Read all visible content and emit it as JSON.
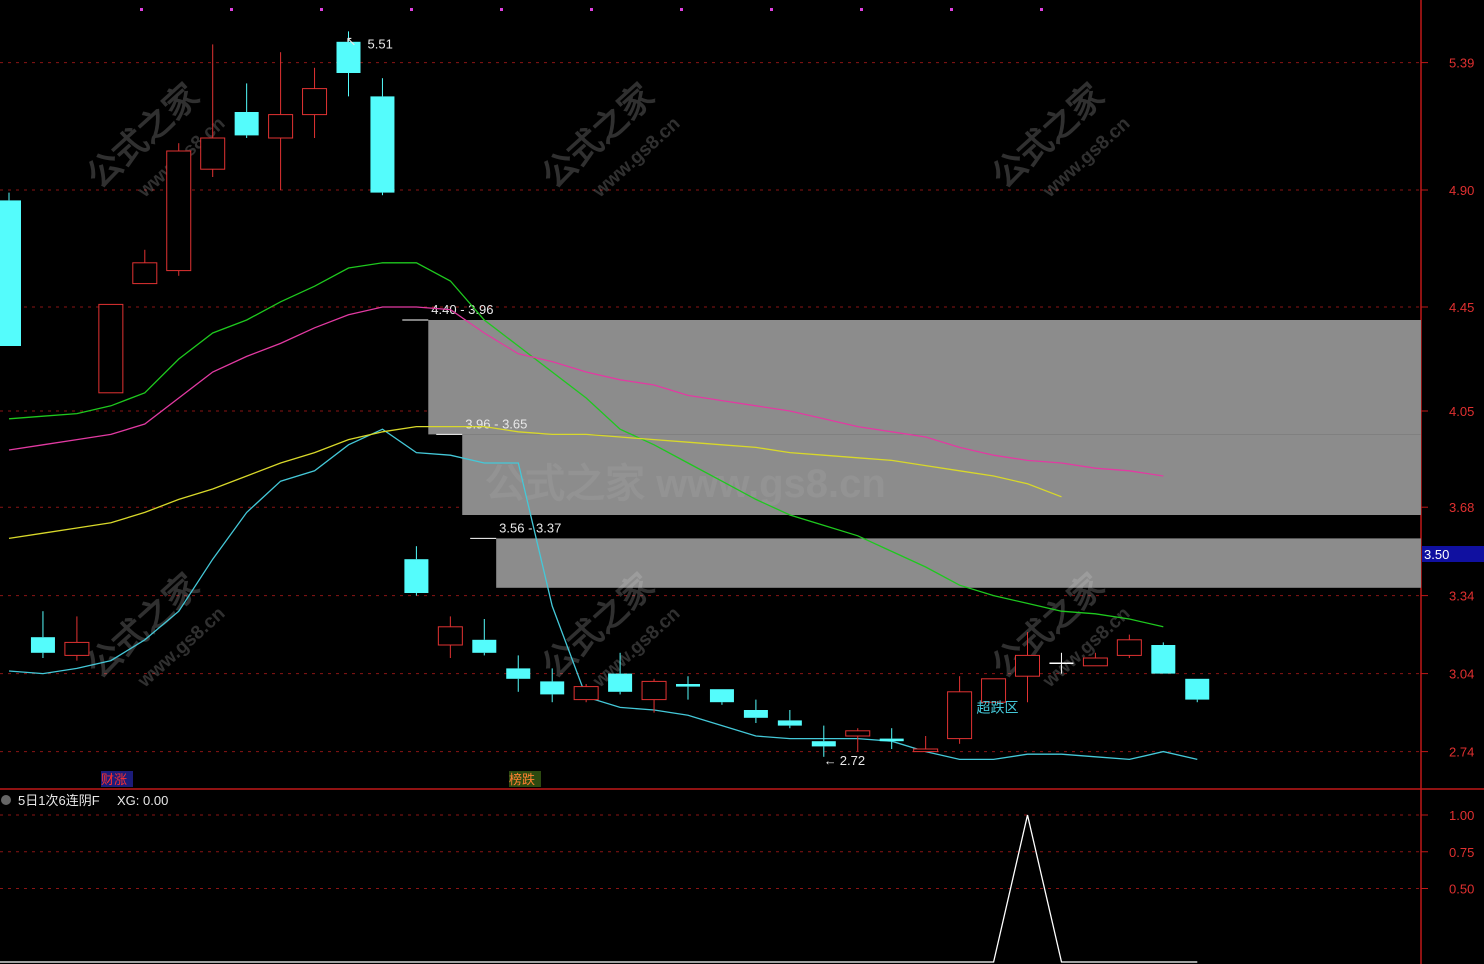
{
  "header": {
    "dots_count": 11
  },
  "chart_data": [
    {
      "type": "candlestick",
      "ylim": [
        2.6,
        5.6
      ],
      "y_ticks": [
        "5.39",
        "4.90",
        "4.45",
        "4.05",
        "3.68",
        "3.34",
        "3.04",
        "2.74"
      ],
      "current_price_label": "3.50",
      "candles": [
        {
          "o": 4.86,
          "c": 4.3,
          "h": 4.89,
          "l": 4.3
        },
        {
          "o": 3.18,
          "c": 3.12,
          "h": 3.28,
          "l": 3.1
        },
        {
          "o": 3.11,
          "c": 3.16,
          "h": 3.26,
          "l": 3.09
        },
        {
          "o": 4.12,
          "c": 4.46,
          "h": 4.46,
          "l": 4.12
        },
        {
          "o": 4.54,
          "c": 4.62,
          "h": 4.67,
          "l": 4.54
        },
        {
          "o": 4.59,
          "c": 5.05,
          "h": 5.08,
          "l": 4.57
        },
        {
          "o": 4.98,
          "c": 5.1,
          "h": 5.46,
          "l": 4.95
        },
        {
          "o": 5.2,
          "c": 5.11,
          "h": 5.31,
          "l": 5.1
        },
        {
          "o": 5.1,
          "c": 5.19,
          "h": 5.43,
          "l": 4.9
        },
        {
          "o": 5.19,
          "c": 5.29,
          "h": 5.37,
          "l": 5.1
        },
        {
          "o": 5.47,
          "c": 5.35,
          "h": 5.51,
          "l": 5.26
        },
        {
          "o": 5.26,
          "c": 4.89,
          "h": 5.33,
          "l": 4.88
        },
        {
          "o": 3.48,
          "c": 3.35,
          "h": 3.53,
          "l": 3.34
        },
        {
          "o": 3.15,
          "c": 3.22,
          "h": 3.26,
          "l": 3.1
        },
        {
          "o": 3.17,
          "c": 3.12,
          "h": 3.25,
          "l": 3.11
        },
        {
          "o": 3.06,
          "c": 3.02,
          "h": 3.11,
          "l": 2.97
        },
        {
          "o": 3.01,
          "c": 2.96,
          "h": 3.06,
          "l": 2.93
        },
        {
          "o": 2.94,
          "c": 2.99,
          "h": 3.0,
          "l": 2.93
        },
        {
          "o": 3.04,
          "c": 2.97,
          "h": 3.12,
          "l": 2.96
        },
        {
          "o": 2.94,
          "c": 3.01,
          "h": 3.02,
          "l": 2.89
        },
        {
          "o": 3.0,
          "c": 2.99,
          "h": 3.03,
          "l": 2.94
        },
        {
          "o": 2.98,
          "c": 2.93,
          "h": 2.98,
          "l": 2.92
        },
        {
          "o": 2.9,
          "c": 2.87,
          "h": 2.94,
          "l": 2.85
        },
        {
          "o": 2.86,
          "c": 2.84,
          "h": 2.9,
          "l": 2.83
        },
        {
          "o": 2.78,
          "c": 2.76,
          "h": 2.84,
          "l": 2.72
        },
        {
          "o": 2.8,
          "c": 2.82,
          "h": 2.83,
          "l": 2.74
        },
        {
          "o": 2.79,
          "c": 2.78,
          "h": 2.83,
          "l": 2.75
        },
        {
          "o": 2.74,
          "c": 2.75,
          "h": 2.8,
          "l": 2.74
        },
        {
          "o": 2.79,
          "c": 2.97,
          "h": 3.03,
          "l": 2.77
        },
        {
          "o": 2.93,
          "c": 3.02,
          "h": 3.02,
          "l": 2.93
        },
        {
          "o": 3.03,
          "c": 3.11,
          "h": 3.2,
          "l": 2.93
        },
        {
          "o": 3.08,
          "c": 3.08,
          "h": 3.12,
          "l": 3.04
        },
        {
          "o": 3.07,
          "c": 3.1,
          "h": 3.12,
          "l": 3.07
        },
        {
          "o": 3.11,
          "c": 3.17,
          "h": 3.19,
          "l": 3.1
        },
        {
          "o": 3.15,
          "c": 3.04,
          "h": 3.16,
          "l": 3.04
        },
        {
          "o": 3.02,
          "c": 2.94,
          "h": 3.02,
          "l": 2.93
        }
      ],
      "lines": [
        {
          "color": "#44c8d8",
          "values": [
            3.05,
            3.04,
            3.06,
            3.09,
            3.17,
            3.28,
            3.48,
            3.66,
            3.78,
            3.82,
            3.92,
            3.98,
            3.89,
            3.88,
            3.85,
            3.85,
            3.3,
            2.95,
            2.91,
            2.9,
            2.88,
            2.84,
            2.8,
            2.79,
            2.79,
            2.79,
            2.78,
            2.74,
            2.71,
            2.71,
            2.73,
            2.73,
            2.72,
            2.71,
            2.74,
            2.71
          ]
        },
        {
          "color": "#1ec81e",
          "values": [
            4.02,
            4.03,
            4.04,
            4.07,
            4.12,
            4.25,
            4.35,
            4.4,
            4.47,
            4.53,
            4.6,
            4.62,
            4.62,
            4.55,
            4.4,
            4.3,
            4.2,
            4.1,
            3.98,
            3.92,
            3.85,
            3.78,
            3.71,
            3.65,
            3.61,
            3.57,
            3.51,
            3.45,
            3.38,
            3.34,
            3.31,
            3.28,
            3.27,
            3.25,
            3.22
          ]
        },
        {
          "color": "#e23aa2",
          "values": [
            3.9,
            3.92,
            3.94,
            3.96,
            4.0,
            4.1,
            4.2,
            4.26,
            4.31,
            4.37,
            4.42,
            4.45,
            4.45,
            4.44,
            4.35,
            4.27,
            4.24,
            4.2,
            4.17,
            4.15,
            4.11,
            4.09,
            4.07,
            4.05,
            4.02,
            3.99,
            3.97,
            3.95,
            3.91,
            3.88,
            3.86,
            3.85,
            3.83,
            3.82,
            3.8
          ]
        },
        {
          "color": "#d8d82a",
          "values": [
            3.56,
            3.58,
            3.6,
            3.62,
            3.66,
            3.71,
            3.75,
            3.8,
            3.85,
            3.89,
            3.94,
            3.97,
            3.99,
            3.99,
            3.99,
            3.97,
            3.96,
            3.96,
            3.95,
            3.94,
            3.93,
            3.92,
            3.91,
            3.89,
            3.88,
            3.87,
            3.86,
            3.84,
            3.82,
            3.8,
            3.77,
            3.72
          ]
        }
      ],
      "zones": [
        {
          "label": "4.40 - 3.96",
          "top": 4.4,
          "bottom": 3.96,
          "start_candle": 12.35
        },
        {
          "label": "3.96 - 3.65",
          "top": 3.96,
          "bottom": 3.65,
          "start_candle": 13.35
        },
        {
          "label": "3.56 - 3.37",
          "top": 3.56,
          "bottom": 3.37,
          "start_candle": 14.35
        }
      ],
      "annotations": {
        "high_label": "5.51",
        "low_label": "2.72",
        "zone_text": "超跌区",
        "tag1": "财涨",
        "tag2": "榜跌"
      }
    },
    {
      "type": "line",
      "title": "5日1次6连阴F",
      "value_label": "XG: 0.00",
      "ylim": [
        0,
        1
      ],
      "y_ticks": [
        "1.00",
        "0.75",
        "0.50"
      ],
      "spike_index": 30,
      "values_count": 36
    }
  ],
  "watermarks": {
    "brand": "公式之家",
    "site": "www.gs8.cn",
    "center": "公式之家 www.gs8.cn"
  }
}
